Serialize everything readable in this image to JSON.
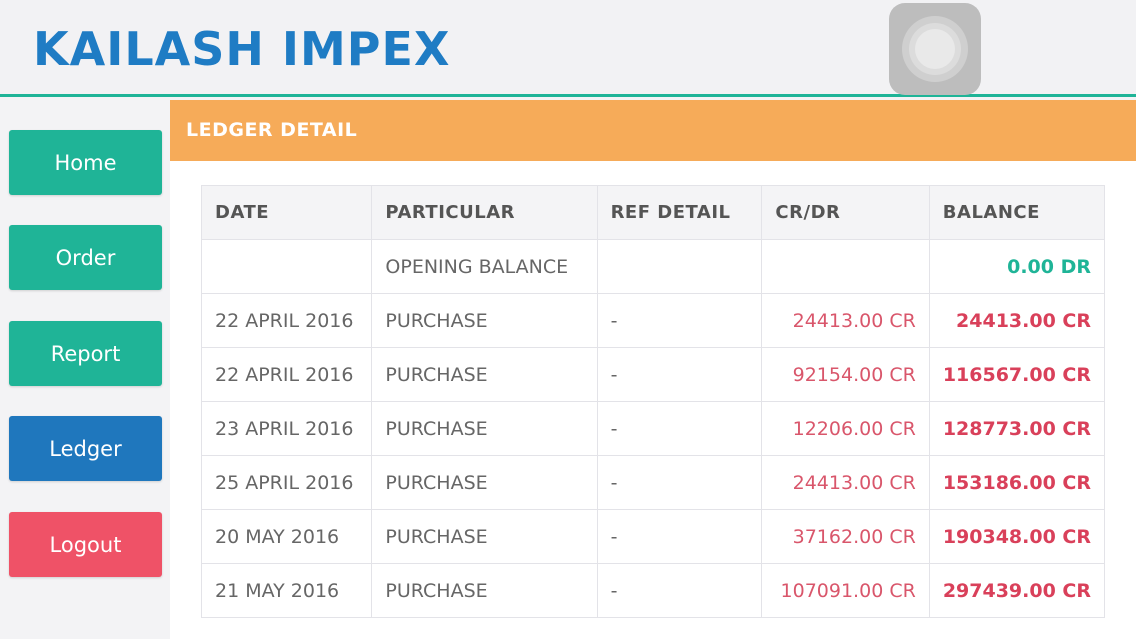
{
  "header": {
    "brand": "KAILASH IMPEX"
  },
  "nav": {
    "home": "Home",
    "order": "Order",
    "report": "Report",
    "ledger": "Ledger",
    "logout": "Logout"
  },
  "page": {
    "title": "LEDGER DETAIL"
  },
  "table": {
    "headers": [
      "DATE",
      "PARTICULAR",
      "REF DETAIL",
      "CR/DR",
      "BALANCE"
    ],
    "rows": [
      {
        "date": "",
        "particular": "OPENING BALANCE",
        "ref": "",
        "crdr": "",
        "balance": "0.00 DR"
      },
      {
        "date": "22 APRIL 2016",
        "particular": "PURCHASE",
        "ref": "-",
        "crdr": "24413.00 CR",
        "balance": "24413.00 CR"
      },
      {
        "date": "22 APRIL 2016",
        "particular": "PURCHASE",
        "ref": "-",
        "crdr": "92154.00 CR",
        "balance": "116567.00 CR"
      },
      {
        "date": "23 APRIL 2016",
        "particular": "PURCHASE",
        "ref": "-",
        "crdr": "12206.00 CR",
        "balance": "128773.00 CR"
      },
      {
        "date": "25 APRIL 2016",
        "particular": "PURCHASE",
        "ref": "-",
        "crdr": "24413.00 CR",
        "balance": "153186.00 CR"
      },
      {
        "date": "20 MAY 2016",
        "particular": "PURCHASE",
        "ref": "-",
        "crdr": "37162.00 CR",
        "balance": "190348.00 CR"
      },
      {
        "date": "21 MAY 2016",
        "particular": "PURCHASE",
        "ref": "-",
        "crdr": "107091.00 CR",
        "balance": "297439.00 CR"
      }
    ]
  },
  "colors": {
    "accent_green": "#1fb497",
    "brand_blue": "#1f77bd",
    "logout_red": "#ef5267",
    "title_orange": "#f6ab59",
    "credit_red": "#d9405a"
  }
}
